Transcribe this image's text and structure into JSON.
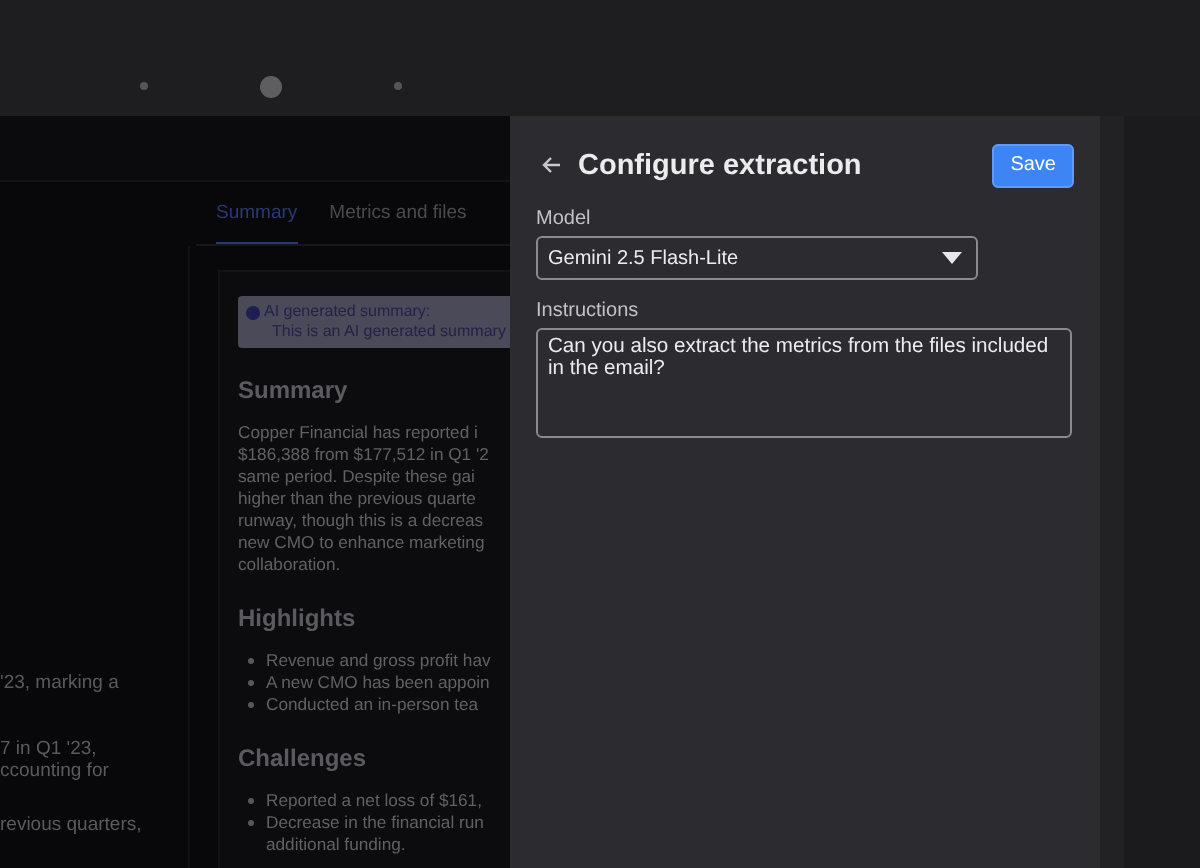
{
  "app": {
    "tabs": [
      {
        "label": "Summary",
        "selected": true
      },
      {
        "label": "Metrics and files",
        "selected": false
      }
    ],
    "left_column": {
      "groups": [
        [
          "'23, marking a"
        ],
        [
          "7 in Q1 '23,",
          "ccounting for"
        ],
        [
          "revious quarters,"
        ]
      ]
    },
    "summary_card": {
      "notice": {
        "title": "AI generated summary:",
        "text": "This is an AI generated summary"
      },
      "sections": [
        {
          "heading": "Summary",
          "kind": "paragraph",
          "lines": [
            "Copper Financial has reported i",
            "$186,388 from $177,512 in Q1 '2",
            "same period. Despite these gai",
            "higher than the previous quarte",
            "runway, though this is a decreas",
            "new CMO to enhance marketing",
            "collaboration."
          ]
        },
        {
          "heading": "Highlights",
          "kind": "bullets",
          "items": [
            {
              "lines": [
                "Revenue and gross profit hav"
              ]
            },
            {
              "lines": [
                "A new CMO has been appoin"
              ]
            },
            {
              "lines": [
                "Conducted an in-person tea"
              ]
            }
          ]
        },
        {
          "heading": "Challenges",
          "kind": "bullets",
          "items": [
            {
              "lines": [
                "Reported a net loss of $161,"
              ]
            },
            {
              "lines": [
                "Decrease in the financial run",
                "additional funding."
              ]
            }
          ]
        }
      ]
    }
  },
  "panel": {
    "title": "Configure extraction",
    "save_button": "Save",
    "model": {
      "label": "Model",
      "value": "Gemini 2.5 Flash-Lite"
    },
    "instructions": {
      "label": "Instructions",
      "value": "Can you also extract the metrics from the files included in the email?"
    }
  }
}
